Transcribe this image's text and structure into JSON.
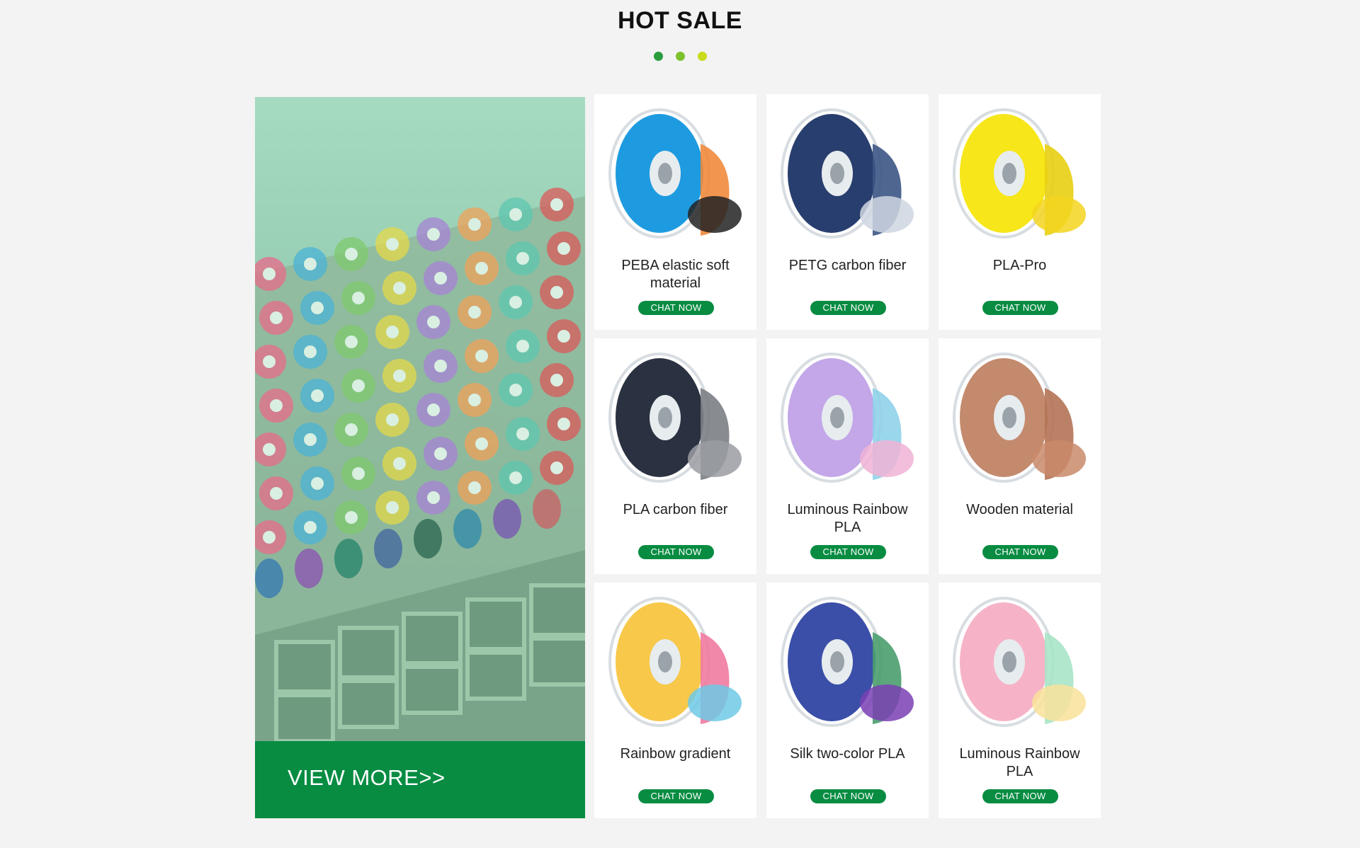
{
  "section": {
    "title": "HOT SALE",
    "dot_colors": [
      "#2a9d3e",
      "#7cc22e",
      "#c8dc1c"
    ]
  },
  "hero": {
    "cta_label": "VIEW MORE>>"
  },
  "products": [
    {
      "name": "PEBA elastic soft material",
      "chat_label": "CHAT NOW",
      "image": "blue-orange-black-filament-and-shoes"
    },
    {
      "name": "PETG carbon fiber",
      "chat_label": "CHAT NOW",
      "image": "navy-filament-and-vase"
    },
    {
      "name": "PLA-Pro",
      "chat_label": "CHAT NOW",
      "image": "yellow-filament-and-hand"
    },
    {
      "name": "PLA carbon fiber",
      "chat_label": "CHAT NOW",
      "image": "dark-filament-and-grey-model"
    },
    {
      "name": "Luminous Rainbow PLA",
      "chat_label": "CHAT NOW",
      "image": "pastel-filament-and-shoe"
    },
    {
      "name": "Wooden material",
      "chat_label": "CHAT NOW",
      "image": "wood-filament-and-bear"
    },
    {
      "name": "Rainbow  gradient",
      "chat_label": "CHAT NOW",
      "image": "rainbow-filament-and-sphere"
    },
    {
      "name": "Silk two-color PLA",
      "chat_label": "CHAT NOW",
      "image": "silk-filament-and-egg"
    },
    {
      "name": "Luminous Rainbow PLA",
      "chat_label": "CHAT NOW",
      "image": "pastel-filament-and-crystals"
    }
  ],
  "palettes": [
    [
      "#1e9be0",
      "#f08a3c",
      "#222222"
    ],
    [
      "#283e6e",
      "#3c5585",
      "#cfd6e0"
    ],
    [
      "#f6e61a",
      "#e8cf12",
      "#f3d51f"
    ],
    [
      "#2a3140",
      "#7b7e84",
      "#9a9ca2"
    ],
    [
      "#c3a7e8",
      "#8fd2ea",
      "#f0b3d6"
    ],
    [
      "#c38a6e",
      "#b47355",
      "#c9896a"
    ],
    [
      "#f7c84a",
      "#ef7aa0",
      "#6fc9e6"
    ],
    [
      "#3b4fa8",
      "#4a9d6e",
      "#7a3fb4"
    ],
    [
      "#f6b3c7",
      "#a7e4c8",
      "#f9e29a"
    ]
  ]
}
